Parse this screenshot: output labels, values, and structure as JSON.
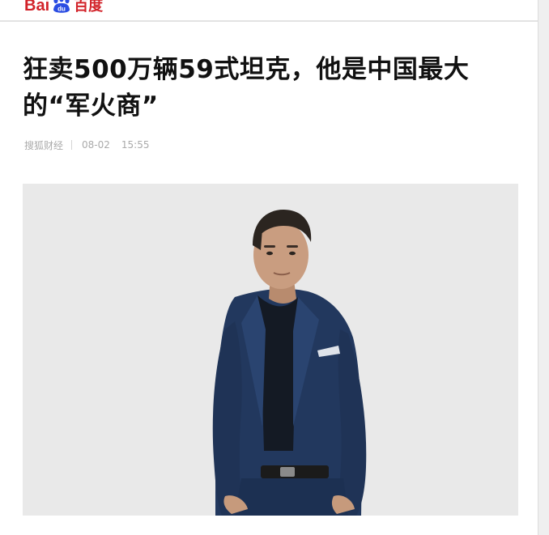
{
  "header": {
    "logo_latin": "Bai",
    "logo_cn": "百度",
    "logo_badge": "du"
  },
  "article": {
    "title": "狂卖500万辆59式坦克，他是中国最大的“军火商”",
    "source": "搜狐财经",
    "date": "08-02",
    "time": "15:55"
  },
  "colors": {
    "brand_red": "#d2232a",
    "brand_blue": "#2b4de2",
    "title": "#111111",
    "meta": "#aaaaaa"
  },
  "icons": {
    "logo_paw": "baidu-paw-icon"
  }
}
